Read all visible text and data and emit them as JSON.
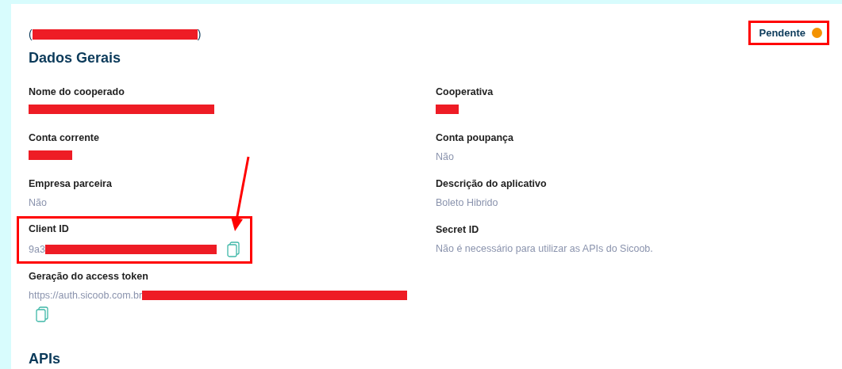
{
  "header": {
    "open_paren": "(",
    "close_paren": ")",
    "redacted": true
  },
  "status": {
    "label": "Pendente",
    "color": "#f39200",
    "highlighted": true
  },
  "section_title": "Dados Gerais",
  "left_fields": [
    {
      "label": "Nome do cooperado",
      "redacted": true
    },
    {
      "label": "Conta corrente",
      "redacted": true
    },
    {
      "label": "Empresa parceira",
      "value": "Não"
    },
    {
      "label": "Client ID",
      "value": "9a3",
      "redacted": true,
      "copy": true,
      "highlighted": true,
      "arrow": true
    },
    {
      "label": "Geração do access token",
      "value": "https://auth.sicoob.com.br",
      "redacted": true,
      "copy": true
    }
  ],
  "right_fields": [
    {
      "label": "Cooperativa",
      "redacted": true
    },
    {
      "label": "Conta poupança",
      "value": "Não"
    },
    {
      "label": "Descrição do aplicativo",
      "value": "Boleto Hibrido"
    },
    {
      "label": "Secret ID",
      "value": "Não é necessário para utilizar as APIs do Sicoob."
    }
  ],
  "next_section_title": "APIs"
}
